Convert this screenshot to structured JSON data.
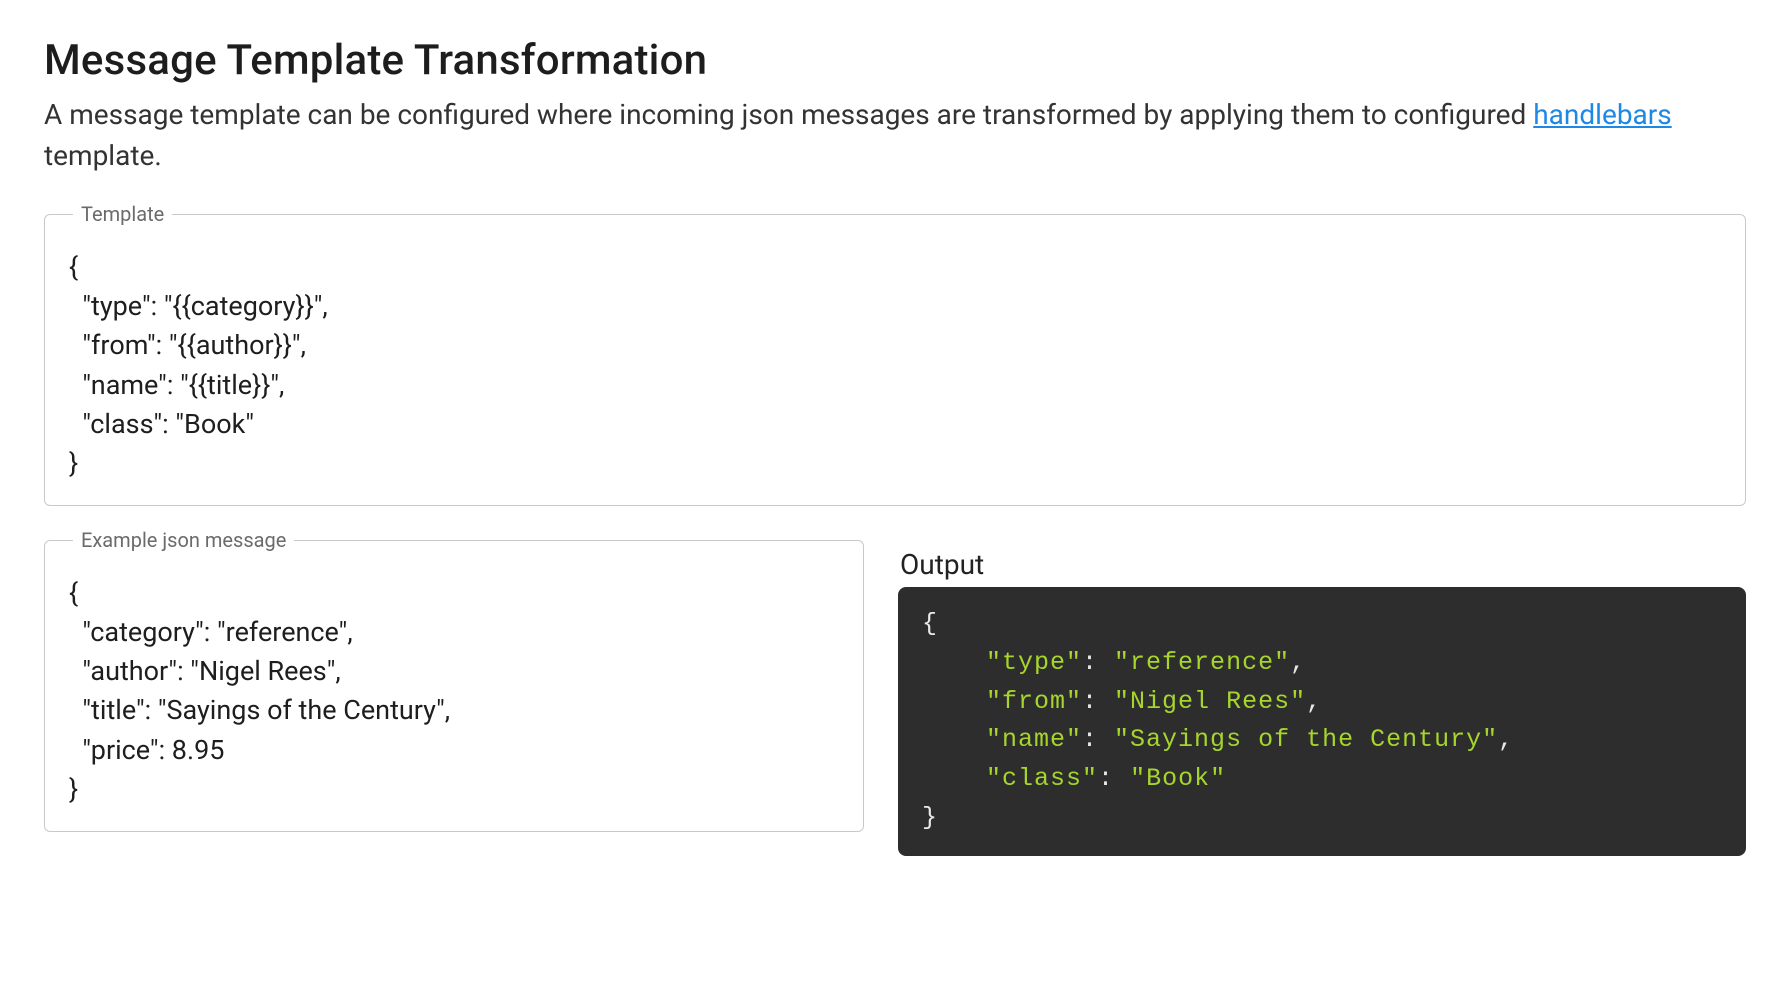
{
  "header": {
    "title": "Message Template Transformation",
    "description_pre": "A message template can be configured where incoming json messages are transformed by applying them to configured ",
    "description_link": "handlebars",
    "description_post": " template."
  },
  "panels": {
    "template": {
      "legend": "Template",
      "content": "{\n  \"type\": \"{{category}}\",\n  \"from\": \"{{author}}\",\n  \"name\": \"{{title}}\",\n  \"class\": \"Book\"\n}"
    },
    "example": {
      "legend": "Example json message",
      "content": "{\n  \"category\": \"reference\",\n  \"author\": \"Nigel Rees\",\n  \"title\": \"Sayings of the Century\",\n  \"price\": 8.95\n}"
    },
    "output": {
      "label": "Output",
      "lines": [
        {
          "brace": "{"
        },
        {
          "key": "\"type\"",
          "sep": ": ",
          "val": "\"reference\"",
          "comma": ","
        },
        {
          "key": "\"from\"",
          "sep": ": ",
          "val": "\"Nigel Rees\"",
          "comma": ","
        },
        {
          "key": "\"name\"",
          "sep": ": ",
          "val": "\"Sayings of the Century\"",
          "comma": ","
        },
        {
          "key": "\"class\"",
          "sep": ": ",
          "val": "\"Book\"",
          "comma": ""
        },
        {
          "brace": "}"
        }
      ]
    }
  }
}
